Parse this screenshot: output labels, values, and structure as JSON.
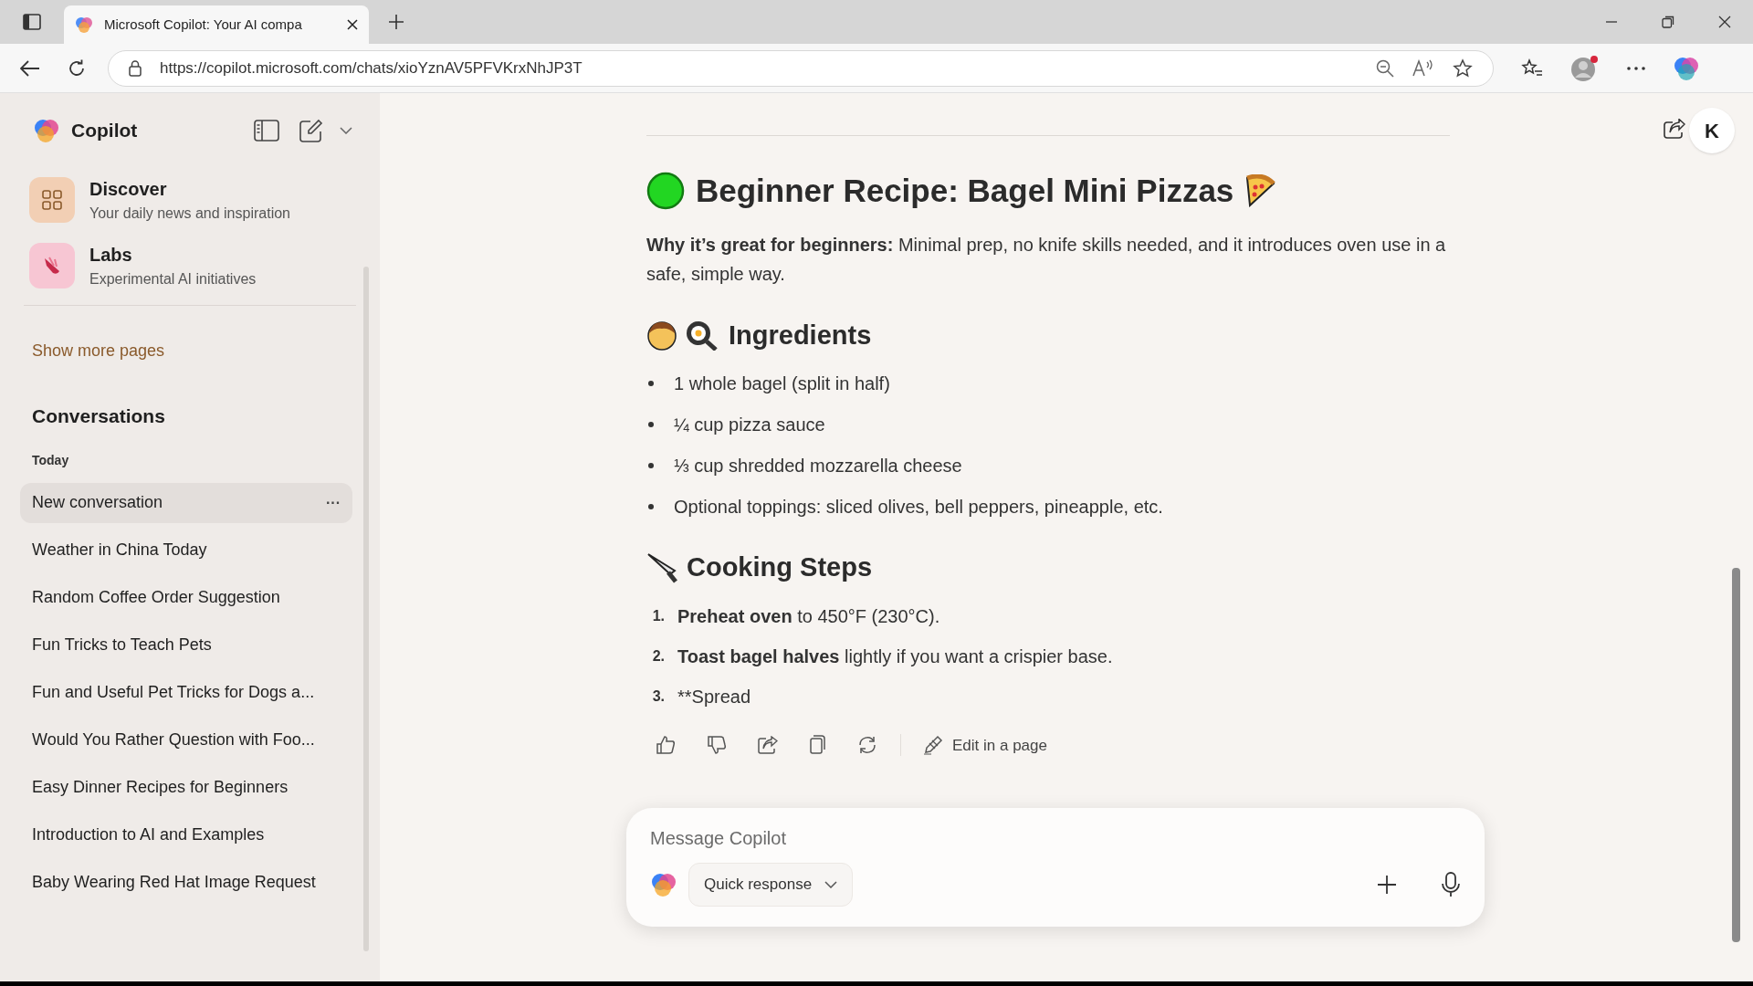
{
  "browser": {
    "tab_title": "Microsoft Copilot: Your AI compa",
    "url": "https://copilot.microsoft.com/chats/xioYznAV5PFVKrxNhJP3T"
  },
  "sidebar": {
    "brand": "Copilot",
    "pages": [
      {
        "kind": "discover",
        "title": "Discover",
        "subtitle": "Your daily news and inspiration"
      },
      {
        "kind": "labs",
        "title": "Labs",
        "subtitle": "Experimental AI initiatives"
      }
    ],
    "show_more": "Show more pages",
    "conversations_heading": "Conversations",
    "group": "Today",
    "more_label": "···",
    "conversations": [
      {
        "title": "New conversation",
        "selected": true
      },
      {
        "title": "Weather in China Today",
        "selected": false
      },
      {
        "title": "Random Coffee Order Suggestion",
        "selected": false
      },
      {
        "title": "Fun Tricks to Teach Pets",
        "selected": false
      },
      {
        "title": "Fun and Useful Pet Tricks for Dogs a...",
        "selected": false
      },
      {
        "title": "Would You Rather Question with Foo...",
        "selected": false
      },
      {
        "title": "Easy Dinner Recipes for Beginners",
        "selected": false
      },
      {
        "title": "Introduction to AI and Examples",
        "selected": false
      },
      {
        "title": "Baby Wearing Red Hat Image Request",
        "selected": false
      }
    ]
  },
  "header": {
    "avatar": "K"
  },
  "message": {
    "title": "Beginner Recipe: Bagel Mini Pizzas",
    "intro": "**Why it’s great for beginners:** Minimal prep, no knife skills needed, and it introduces oven use in a safe, simple way.",
    "ingredients_heading": "Ingredients",
    "ingredients": [
      "1 whole bagel (split in half)",
      "¼ cup pizza sauce",
      "⅓ cup shredded mozzarella cheese",
      "Optional toppings: sliced olives, bell peppers, pineapple, etc."
    ],
    "steps_heading": "Cooking Steps",
    "steps": [
      {
        "number": "1.",
        "text": "**Preheat oven** to 450°F (230°C)."
      },
      {
        "number": "2.",
        "text": "**Toast bagel halves** lightly if you want a crispier base."
      },
      {
        "number": "3.",
        "text": "**Spread"
      }
    ],
    "edit_label": "Edit in a page"
  },
  "composer": {
    "placeholder": "Message Copilot",
    "mode": "Quick response"
  }
}
